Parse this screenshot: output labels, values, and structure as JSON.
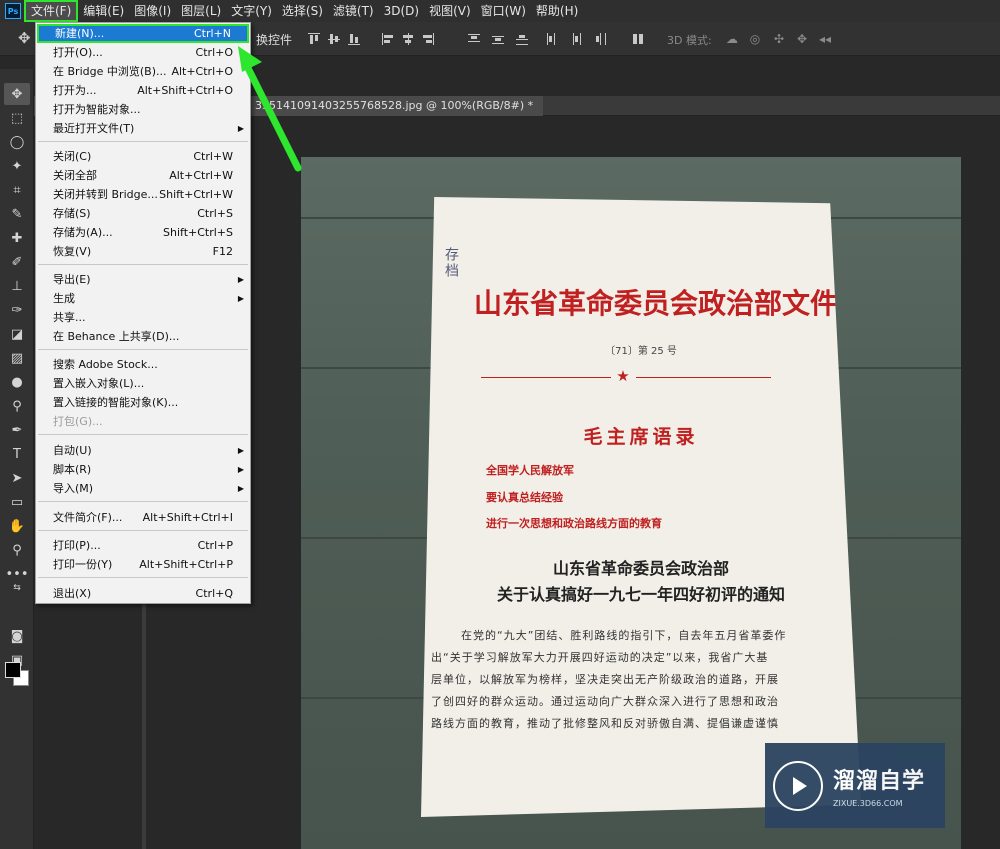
{
  "menubar": {
    "logo": "Ps",
    "items": [
      "文件(F)",
      "编辑(E)",
      "图像(I)",
      "图层(L)",
      "文字(Y)",
      "选择(S)",
      "滤镜(T)",
      "3D(D)",
      "视图(V)",
      "窗口(W)",
      "帮助(H)"
    ]
  },
  "options_bar": {
    "transform_label": "换控件",
    "mode3d_label": "3D 模式:"
  },
  "document_tab": {
    "title": "335141091403255768528.jpg @ 100%(RGB/8#) *"
  },
  "file_menu": {
    "groups": [
      [
        {
          "label": "新建(N)...",
          "shortcut": "Ctrl+N",
          "highlighted": true
        },
        {
          "label": "打开(O)...",
          "shortcut": "Ctrl+O"
        },
        {
          "label": "在 Bridge 中浏览(B)...",
          "shortcut": "Alt+Ctrl+O"
        },
        {
          "label": "打开为...",
          "shortcut": "Alt+Shift+Ctrl+O"
        },
        {
          "label": "打开为智能对象..."
        },
        {
          "label": "最近打开文件(T)",
          "submenu": true
        }
      ],
      [
        {
          "label": "关闭(C)",
          "shortcut": "Ctrl+W"
        },
        {
          "label": "关闭全部",
          "shortcut": "Alt+Ctrl+W"
        },
        {
          "label": "关闭并转到 Bridge...",
          "shortcut": "Shift+Ctrl+W"
        },
        {
          "label": "存储(S)",
          "shortcut": "Ctrl+S"
        },
        {
          "label": "存储为(A)...",
          "shortcut": "Shift+Ctrl+S"
        },
        {
          "label": "恢复(V)",
          "shortcut": "F12"
        }
      ],
      [
        {
          "label": "导出(E)",
          "submenu": true
        },
        {
          "label": "生成",
          "submenu": true
        },
        {
          "label": "共享..."
        },
        {
          "label": "在 Behance 上共享(D)..."
        }
      ],
      [
        {
          "label": "搜索 Adobe Stock..."
        },
        {
          "label": "置入嵌入对象(L)..."
        },
        {
          "label": "置入链接的智能对象(K)..."
        },
        {
          "label": "打包(G)...",
          "disabled": true
        }
      ],
      [
        {
          "label": "自动(U)",
          "submenu": true
        },
        {
          "label": "脚本(R)",
          "submenu": true
        },
        {
          "label": "导入(M)",
          "submenu": true
        }
      ],
      [
        {
          "label": "文件简介(F)...",
          "shortcut": "Alt+Shift+Ctrl+I"
        }
      ],
      [
        {
          "label": "打印(P)...",
          "shortcut": "Ctrl+P"
        },
        {
          "label": "打印一份(Y)",
          "shortcut": "Alt+Shift+Ctrl+P"
        }
      ],
      [
        {
          "label": "退出(X)",
          "shortcut": "Ctrl+Q"
        }
      ]
    ]
  },
  "document_image": {
    "handwritten_note": "存档",
    "title": "山东省革命委员会政治部文件",
    "number": "〔71〕第 25 号",
    "quote_title": "毛主席语录",
    "quotes": [
      "全国学人民解放军",
      "要认真总结经验",
      "进行一次思想和政治路线方面的教育"
    ],
    "headings": [
      "山东省革命委员会政治部",
      "关于认真搞好一九七一年四好初评的通知"
    ],
    "body": [
      "在党的“九大”团结、胜利路线的指引下，自去年五月省革委作",
      "出“关于学习解放军大力开展四好运动的决定”以来，我省广大基",
      "层单位，以解放军为榜样，坚决走突出无产阶级政治的道路，开展",
      "了创四好的群众运动。通过运动向广大群众深入进行了思想和政治",
      "路线方面的教育，推动了批修整风和反对骄傲自满、提倡谦虚谨慎"
    ]
  },
  "watermark": {
    "name": "溜溜自学",
    "url": "ZIXUE.3D66.COM"
  },
  "colors": {
    "highlight": "#1c7ad3",
    "annotation_green": "#2ee62e",
    "doc_red": "#c02020"
  }
}
